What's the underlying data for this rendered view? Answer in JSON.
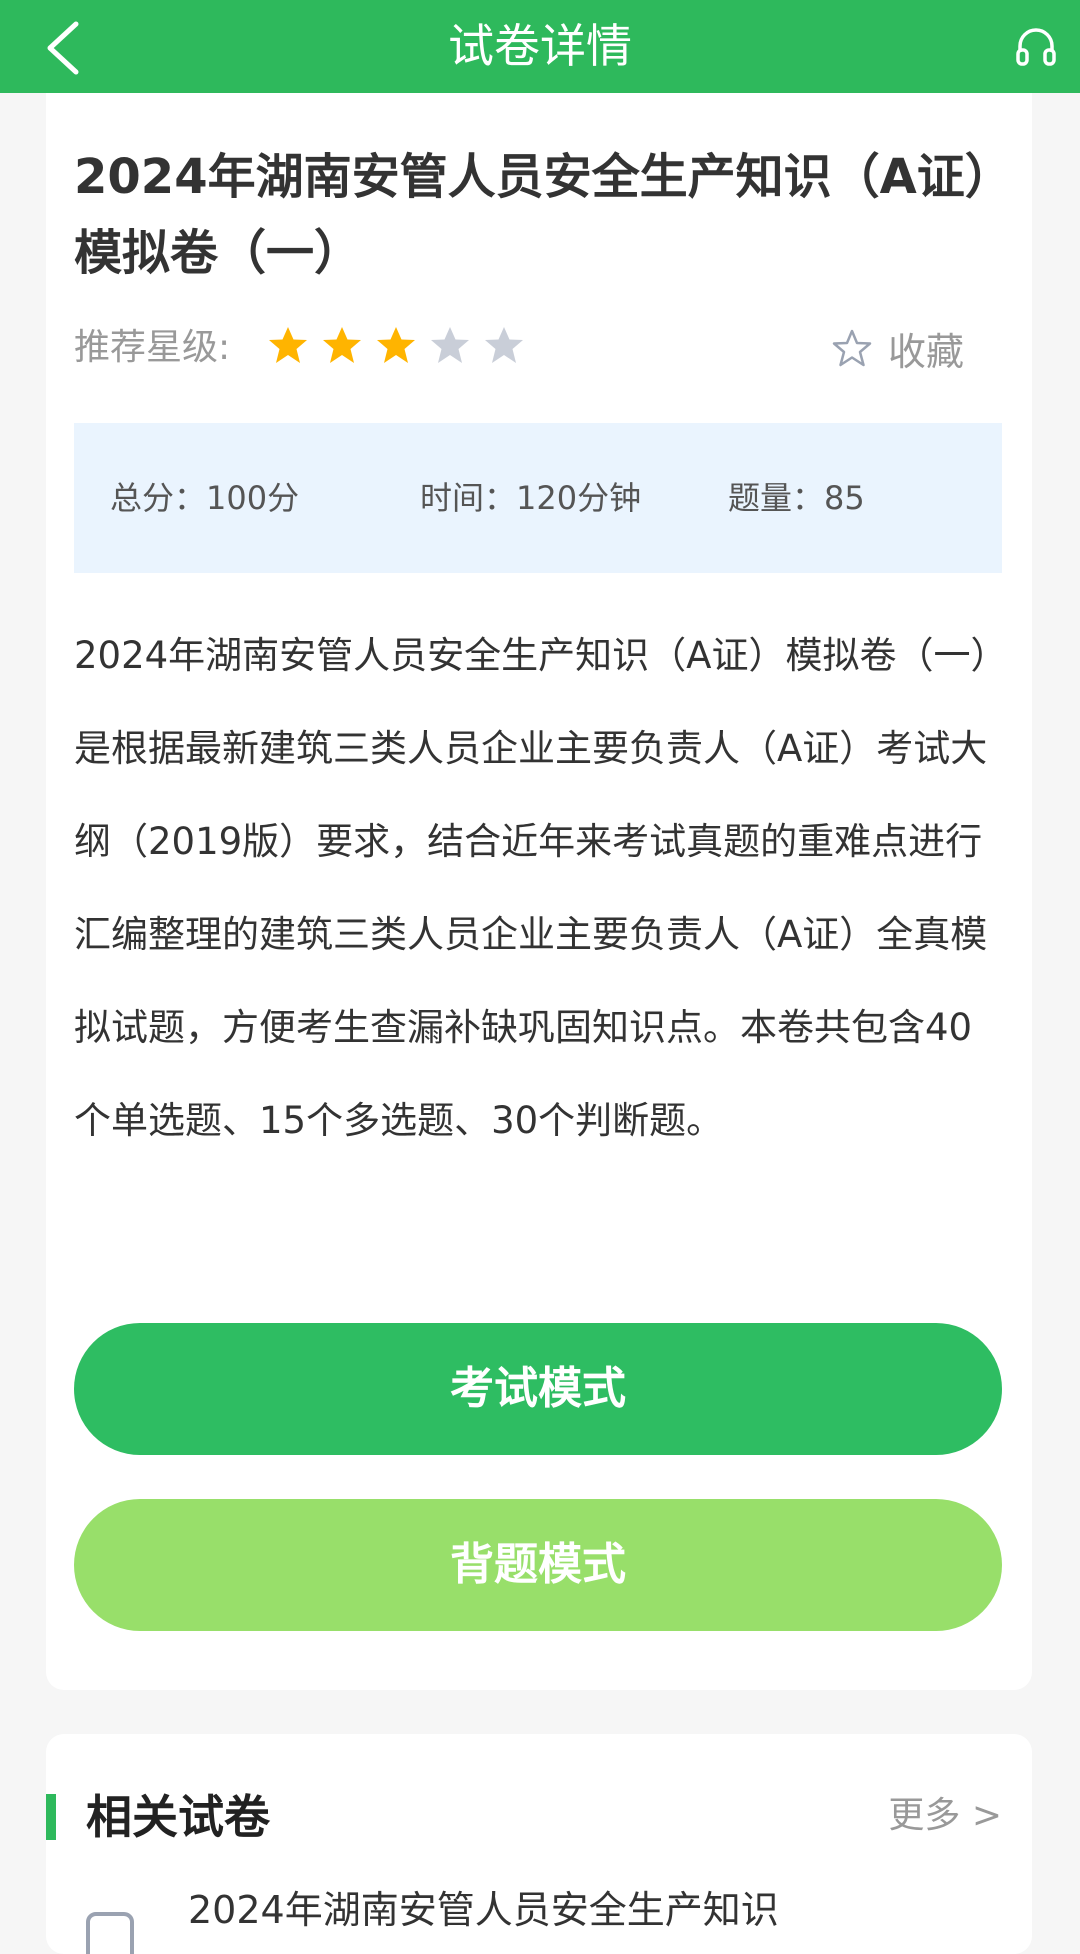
{
  "topbar": {
    "title": "试卷详情",
    "back_icon": "chevron-left-icon",
    "right_icon": "headset-icon"
  },
  "paper": {
    "title": "2024年湖南安管人员安全生产知识（A证）模拟卷（一）",
    "rating_label": "推荐星级:",
    "rating": 3,
    "rating_max": 5,
    "favorite_label": "收藏",
    "info": {
      "total_score": "总分：100分",
      "time": "时间：120分钟",
      "count": "题量：85"
    },
    "description": "2024年湖南安管人员安全生产知识（A证）模拟卷（一）是根据最新建筑三类人员企业主要负责人（A证）考试大纲（2019版）要求，结合近年来考试真题的重难点进行汇编整理的建筑三类人员企业主要负责人（A证）全真模拟试题，方便考生查漏补缺巩固知识点。本卷共包含40个单选题、15个多选题、30个判断题。",
    "exam_mode_label": "考试模式",
    "study_mode_label": "背题模式"
  },
  "related": {
    "heading": "相关试卷",
    "more_label": "更多 >",
    "items": [
      {
        "title": "2024年湖南安管人员安全生产知识"
      }
    ]
  },
  "colors": {
    "primary": "#2eb95c",
    "star_on": "#ffb400",
    "star_off": "#c9ced8",
    "study_button": "#98df6a",
    "info_bg": "#eaf4fe"
  }
}
